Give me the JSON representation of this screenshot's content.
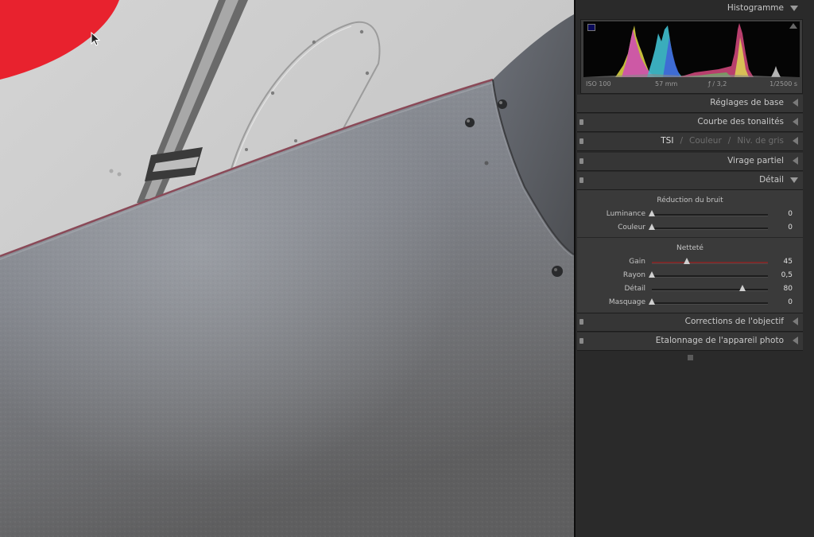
{
  "histogram": {
    "title": "Histogramme",
    "iso": "ISO 100",
    "focal": "57 mm",
    "aperture": "ƒ / 3,2",
    "shutter": "1/2500 s"
  },
  "panels": {
    "basic": "Réglages de base",
    "tone_curve": "Courbe des tonalités",
    "hsl_tabs": [
      "TSI",
      "Couleur",
      "Niv. de gris"
    ],
    "split_toning": "Virage partiel",
    "detail": "Détail",
    "lens_corrections": "Corrections de l'objectif",
    "camera_calibration": "Etalonnage de l'appareil photo"
  },
  "detail": {
    "noise_reduction": {
      "title": "Réduction du bruit",
      "sliders": [
        {
          "label": "Luminance",
          "value": "0",
          "level": 0
        },
        {
          "label": "Couleur",
          "value": "0",
          "level": 0
        }
      ]
    },
    "sharpening": {
      "title": "Netteté",
      "sliders": [
        {
          "label": "Gain",
          "value": "45",
          "level": 0.3
        },
        {
          "label": "Rayon",
          "value": "0,5",
          "level": 0.0
        },
        {
          "label": "Détail",
          "value": "80",
          "level": 0.78
        },
        {
          "label": "Masquage",
          "value": "0",
          "level": 0
        }
      ]
    }
  },
  "colors": {
    "panel_bg": "#2a2a2a",
    "header_bg": "#363636",
    "detail_bg": "#3a3a3a",
    "gain_fill": "#7a2a2a"
  }
}
